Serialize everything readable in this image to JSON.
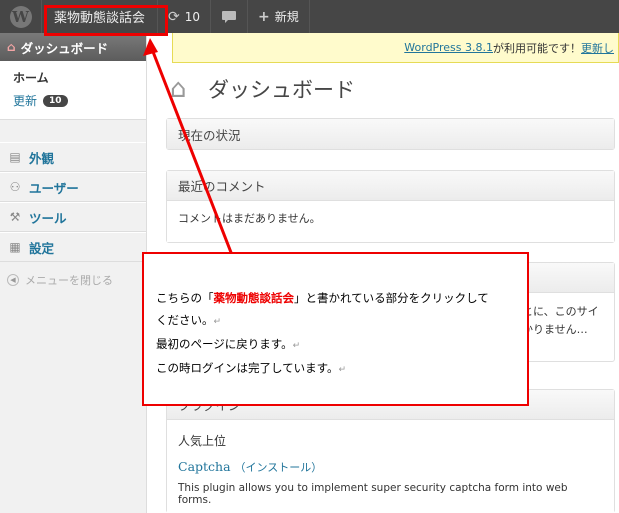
{
  "adminbar": {
    "logo": "W",
    "site_name": "薬物動態談話会",
    "updates_count": "10",
    "new_label": "新規",
    "icons": {
      "logo": "wordpress-icon",
      "updates": "refresh-icon",
      "comments": "comment-icon",
      "new": "plus-icon"
    }
  },
  "nag": {
    "link": "WordPress 3.8.1",
    "text": " が利用可能です！",
    "update_link": "更新し"
  },
  "sidebar": {
    "dashboard_label": "ダッシュボード",
    "home_label": "ホーム",
    "updates_label": "更新",
    "updates_badge": "10",
    "items": [
      {
        "label": "外観",
        "icon": "appearance-icon"
      },
      {
        "label": "ユーザー",
        "icon": "users-icon"
      },
      {
        "label": "ツール",
        "icon": "tools-icon"
      },
      {
        "label": "設定",
        "icon": "settings-icon"
      }
    ],
    "collapse_label": "メニューを閉じる"
  },
  "main": {
    "title": "ダッシュボード",
    "right_now_title": "現在の状況",
    "recent_comments_title": "最近のコメント",
    "no_comments_text": "コメントはまだありません。",
    "partial_text_1": "とに、このサイ",
    "partial_text_2": "かりません…",
    "plugins_title": "プラグイン",
    "popular_label": "人気上位",
    "plugin_name": "Captcha",
    "install_label": "（インストール）",
    "plugin_desc": "This plugin allows you to implement super security captcha form into web forms."
  },
  "callout": {
    "line1_prefix": "こちらの「",
    "line1_highlight": "薬物動態談話会",
    "line1_suffix": "」と書かれている部分をクリックして",
    "line2": "ください。",
    "line3": "最初のページに戻ります。",
    "line4": "この時ログインは完了しています。",
    "return_mark": "↵"
  },
  "colors": {
    "highlight": "#ee0000",
    "link": "#21759b",
    "adminbar": "#464646"
  }
}
